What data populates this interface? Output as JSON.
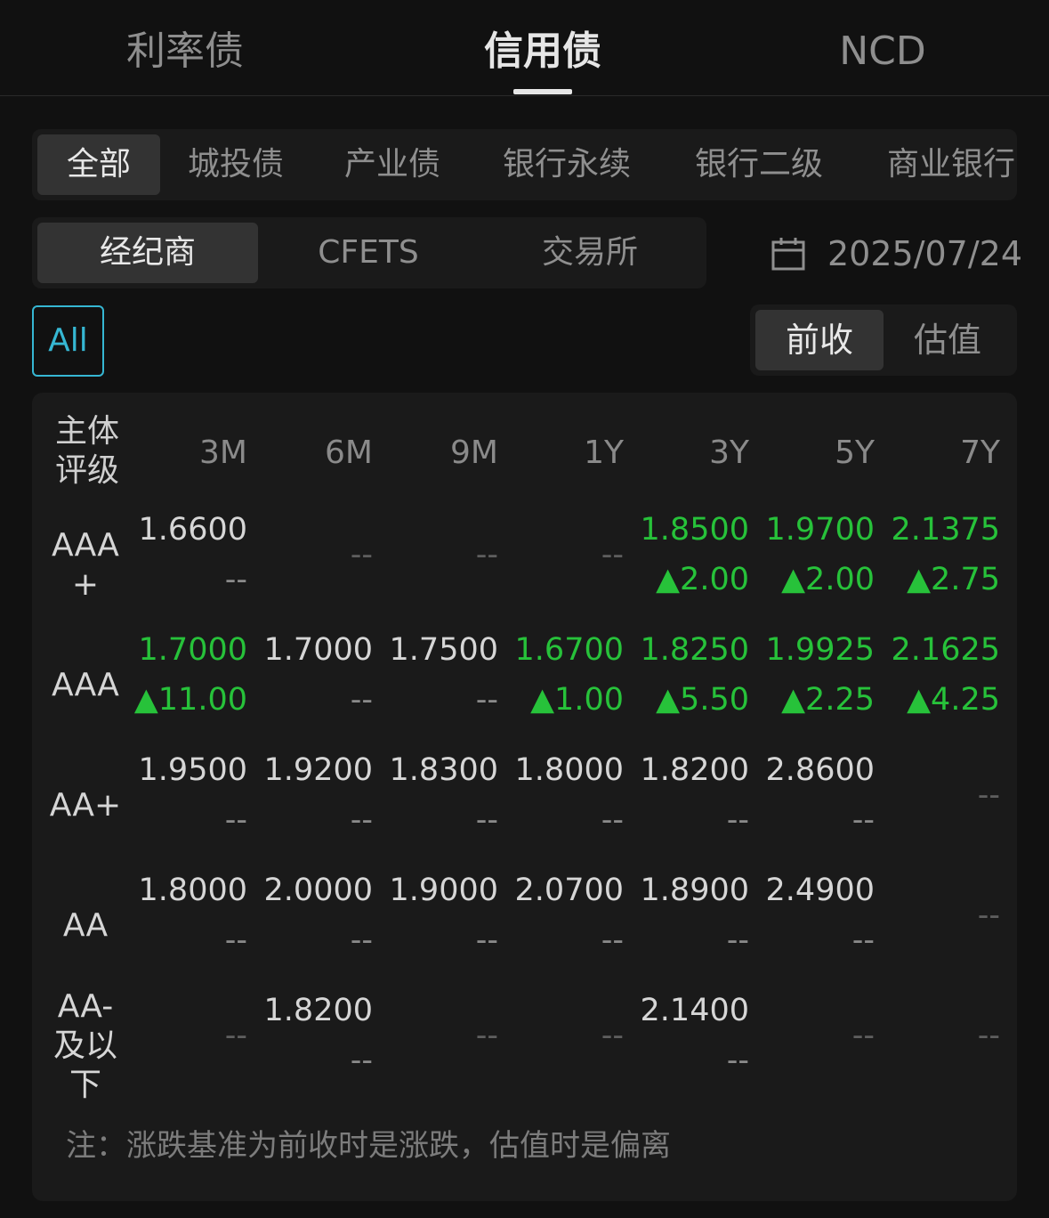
{
  "top_tabs": [
    "利率债",
    "信用债",
    "NCD"
  ],
  "categories": [
    "全部",
    "城投债",
    "产业债",
    "银行永续",
    "银行二级",
    "商业银行"
  ],
  "sources": [
    "经纪商",
    "CFETS",
    "交易所"
  ],
  "date": "2025/07/24",
  "all_label": "All",
  "modes": [
    "前收",
    "估值"
  ],
  "table": {
    "rating_header": "主体\n评级",
    "columns": [
      "3M",
      "6M",
      "9M",
      "1Y",
      "3Y",
      "5Y",
      "7Y"
    ],
    "rows": [
      {
        "rating": "AAA\n+",
        "cells": [
          {
            "v": "1.6600",
            "c": "--",
            "g": false
          },
          {
            "v": "",
            "c": "--",
            "g": false
          },
          {
            "v": "",
            "c": "--",
            "g": false
          },
          {
            "v": "",
            "c": "--",
            "g": false
          },
          {
            "v": "1.8500",
            "c": "▲2.00",
            "g": true
          },
          {
            "v": "1.9700",
            "c": "▲2.00",
            "g": true
          },
          {
            "v": "2.1375",
            "c": "▲2.75",
            "g": true
          }
        ]
      },
      {
        "rating": "AAA",
        "cells": [
          {
            "v": "1.7000",
            "c": "▲11.00",
            "g": true
          },
          {
            "v": "1.7000",
            "c": "--",
            "g": false
          },
          {
            "v": "1.7500",
            "c": "--",
            "g": false
          },
          {
            "v": "1.6700",
            "c": "▲1.00",
            "g": true
          },
          {
            "v": "1.8250",
            "c": "▲5.50",
            "g": true
          },
          {
            "v": "1.9925",
            "c": "▲2.25",
            "g": true
          },
          {
            "v": "2.1625",
            "c": "▲4.25",
            "g": true
          }
        ]
      },
      {
        "rating": "AA+",
        "cells": [
          {
            "v": "1.9500",
            "c": "--",
            "g": false
          },
          {
            "v": "1.9200",
            "c": "--",
            "g": false
          },
          {
            "v": "1.8300",
            "c": "--",
            "g": false
          },
          {
            "v": "1.8000",
            "c": "--",
            "g": false
          },
          {
            "v": "1.8200",
            "c": "--",
            "g": false
          },
          {
            "v": "2.8600",
            "c": "--",
            "g": false
          },
          {
            "v": "",
            "c": "--",
            "g": false
          }
        ]
      },
      {
        "rating": "AA",
        "cells": [
          {
            "v": "1.8000",
            "c": "--",
            "g": false
          },
          {
            "v": "2.0000",
            "c": "--",
            "g": false
          },
          {
            "v": "1.9000",
            "c": "--",
            "g": false
          },
          {
            "v": "2.0700",
            "c": "--",
            "g": false
          },
          {
            "v": "1.8900",
            "c": "--",
            "g": false
          },
          {
            "v": "2.4900",
            "c": "--",
            "g": false
          },
          {
            "v": "",
            "c": "--",
            "g": false
          }
        ]
      },
      {
        "rating": "AA-\n及以\n下",
        "cells": [
          {
            "v": "",
            "c": "--",
            "g": false
          },
          {
            "v": "1.8200",
            "c": "--",
            "g": false
          },
          {
            "v": "",
            "c": "--",
            "g": false
          },
          {
            "v": "",
            "c": "--",
            "g": false
          },
          {
            "v": "2.1400",
            "c": "--",
            "g": false
          },
          {
            "v": "",
            "c": "--",
            "g": false
          },
          {
            "v": "",
            "c": "--",
            "g": false
          }
        ]
      }
    ]
  },
  "note": "注：涨跌基准为前收时是涨跌，估值时是偏离",
  "colors": {
    "accent": "#36b7d3",
    "up": "#27c23a",
    "bg": "#111111",
    "panel": "#1a1a1a"
  }
}
